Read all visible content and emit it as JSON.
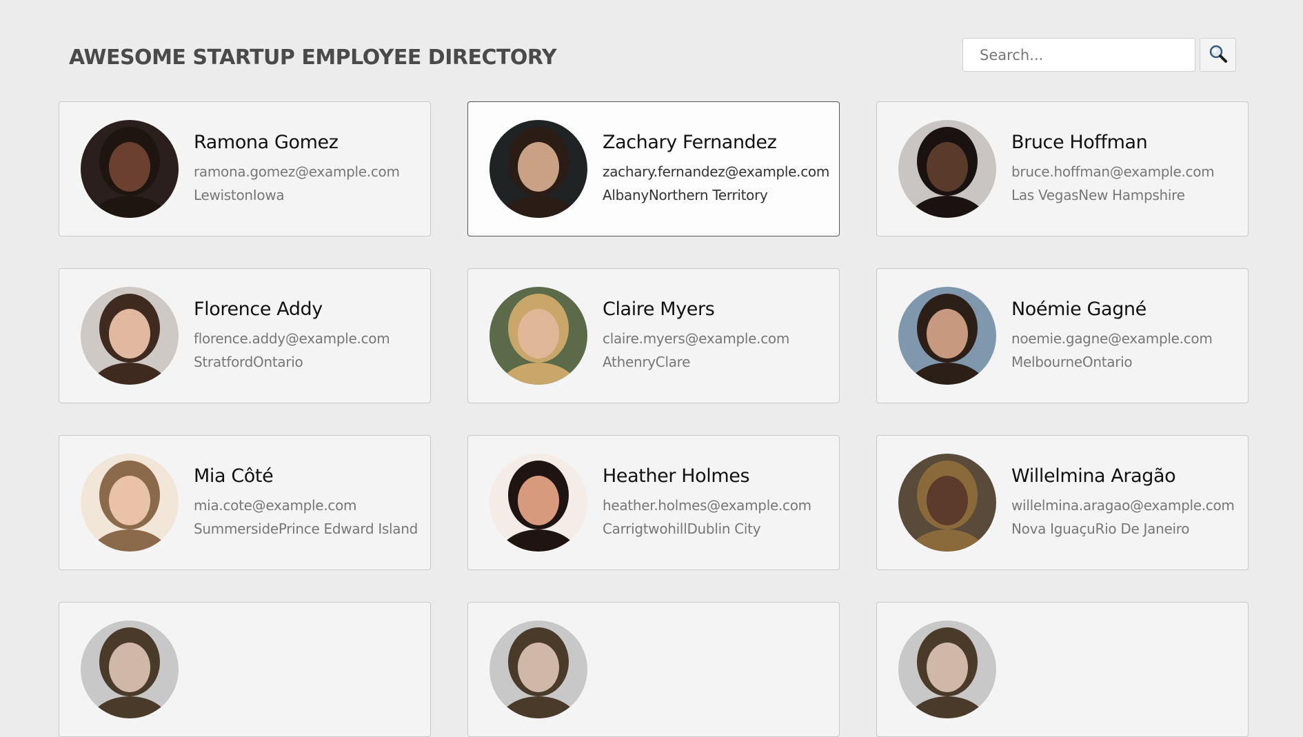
{
  "header": {
    "title": "AWESOME STARTUP EMPLOYEE DIRECTORY",
    "search_placeholder": "Search...",
    "search_icon": "magnifier-icon"
  },
  "employees": [
    {
      "name": "Ramona Gomez",
      "email": "ramona.gomez@example.com",
      "location": "LewistonIowa",
      "skin": "#6b4030",
      "hair": "#1e1410",
      "bg": "#2a1f1c"
    },
    {
      "name": "Zachary Fernandez",
      "email": "zachary.fernandez@example.com",
      "location": "AlbanyNorthern Territory",
      "skin": "#c9a184",
      "hair": "#2b1d15",
      "bg": "#1f2324"
    },
    {
      "name": "Bruce Hoffman",
      "email": "bruce.hoffman@example.com",
      "location": "Las VegasNew Hampshire",
      "skin": "#5a3a2a",
      "hair": "#1a1210",
      "bg": "#c9c5c2"
    },
    {
      "name": "Florence Addy",
      "email": "florence.addy@example.com",
      "location": "StratfordOntario",
      "skin": "#e1b8a0",
      "hair": "#3e2a1e",
      "bg": "#cfc9c5"
    },
    {
      "name": "Claire Myers",
      "email": "claire.myers@example.com",
      "location": "AthenryClare",
      "skin": "#e0b898",
      "hair": "#c9a76a",
      "bg": "#5b6b4a"
    },
    {
      "name": "Noémie Gagné",
      "email": "noemie.gagne@example.com",
      "location": "MelbourneOntario",
      "skin": "#c79a80",
      "hair": "#2c1f18",
      "bg": "#7f98ad"
    },
    {
      "name": "Mia Côté",
      "email": "mia.cote@example.com",
      "location": "SummersidePrince Edward Island",
      "skin": "#e9c2a8",
      "hair": "#8a6a4a",
      "bg": "#f2e6d8"
    },
    {
      "name": "Heather Holmes",
      "email": "heather.holmes@example.com",
      "location": "CarrigtwohillDublin City",
      "skin": "#d79a7c",
      "hair": "#1f1412",
      "bg": "#f4ece6"
    },
    {
      "name": "Willelmina Aragão",
      "email": "willelmina.aragao@example.com",
      "location": "Nova IguaçuRio De Janeiro",
      "skin": "#5c3b2c",
      "hair": "#8a6a3a",
      "bg": "#5a4a3a"
    },
    {
      "name": "",
      "email": "",
      "location": "",
      "skin": "#d0b8a8",
      "hair": "#4a3a2a",
      "bg": "#c8c8c8"
    },
    {
      "name": "",
      "email": "",
      "location": "",
      "skin": "#d0b8a8",
      "hair": "#4a3a2a",
      "bg": "#c8c8c8"
    },
    {
      "name": "",
      "email": "",
      "location": "",
      "skin": "#d0b8a8",
      "hair": "#4a3a2a",
      "bg": "#c8c8c8"
    }
  ],
  "active_card": 1
}
